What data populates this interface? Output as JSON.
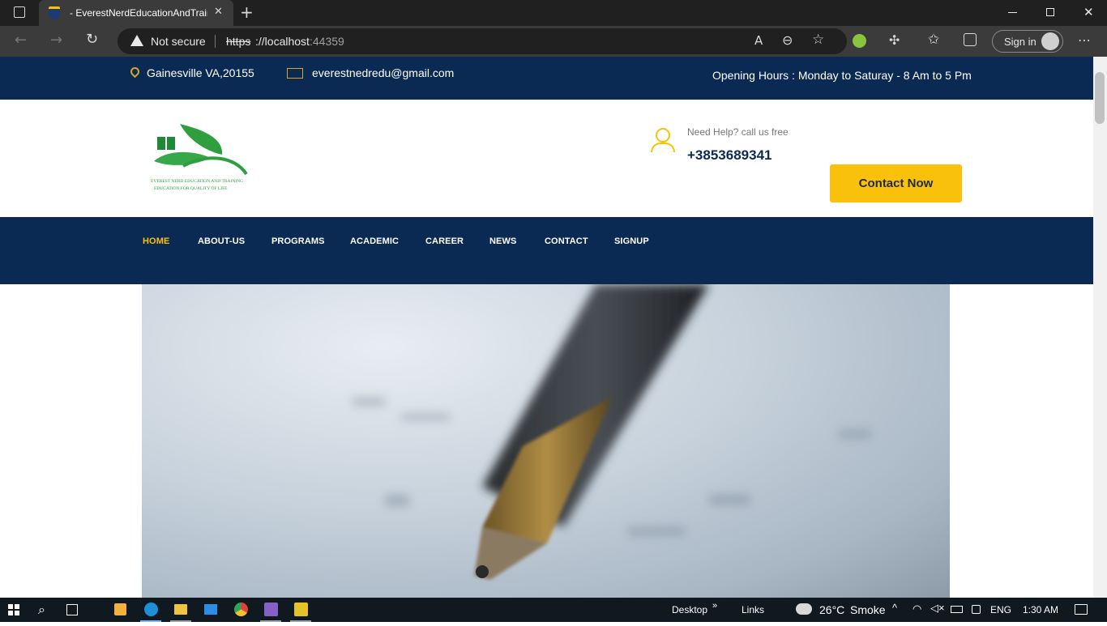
{
  "browser": {
    "tab_title": "- EverestNerdEducationAndTrain",
    "not_secure": "Not secure",
    "url_scheme": "https",
    "url_host": "://localhost",
    "url_port": ":44359",
    "sign_in": "Sign in"
  },
  "topbar": {
    "location": "Gainesville VA,20155",
    "email": "everestnedredu@gmail.com",
    "hours": "Opening Hours : Monday to Saturay - 8 Am to 5 Pm"
  },
  "header": {
    "logo_line1": "EVEREST NERD EDUCATION AND TRAINING",
    "logo_line2": "EDUCATION FOR QUALITY OF LIFE",
    "help_text": "Need Help? call us free",
    "phone": "+3853689341",
    "contact_button": "Contact Now"
  },
  "nav": {
    "items": [
      {
        "label": "HOME",
        "active": true
      },
      {
        "label": "ABOUT-US",
        "active": false
      },
      {
        "label": "PROGRAMS",
        "active": false
      },
      {
        "label": "ACADEMIC",
        "active": false
      },
      {
        "label": "CAREER",
        "active": false
      },
      {
        "label": "NEWS",
        "active": false
      },
      {
        "label": "CONTACT",
        "active": false
      },
      {
        "label": "SIGNUP",
        "active": false
      }
    ]
  },
  "taskbar": {
    "desktop": "Desktop",
    "links": "Links",
    "temperature": "26°C",
    "weather": "Smoke",
    "language": "ENG",
    "time": "1:30 AM"
  },
  "colors": {
    "navy": "#0b2a53",
    "accent_yellow": "#f9c10b",
    "active_nav": "#f9c10b"
  }
}
